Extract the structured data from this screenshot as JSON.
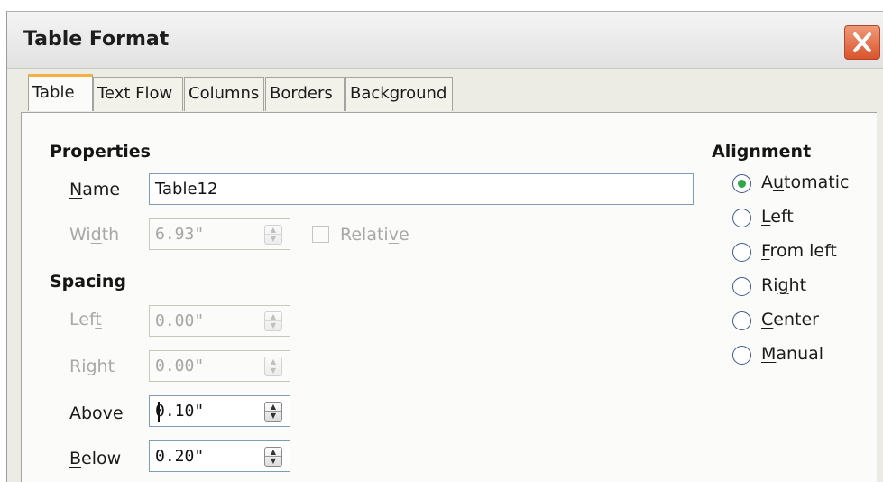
{
  "window": {
    "title": "Table Format"
  },
  "tabs": [
    {
      "label": "Table",
      "active": true
    },
    {
      "label": "Text Flow",
      "active": false
    },
    {
      "label": "Columns",
      "active": false
    },
    {
      "label": "Borders",
      "active": false
    },
    {
      "label": "Background",
      "active": false
    }
  ],
  "properties": {
    "heading": "Properties",
    "name": {
      "label_pre": "",
      "label_u": "N",
      "label_post": "ame",
      "value": "Table12"
    },
    "width": {
      "label_pre": "Wi",
      "label_u": "d",
      "label_post": "th",
      "value": "6.93\""
    },
    "relative": {
      "label_pre": "Relati",
      "label_u": "v",
      "label_post": "e",
      "checked": false
    }
  },
  "spacing": {
    "heading": "Spacing",
    "left": {
      "label_pre": "Lef",
      "label_u": "t",
      "label_post": "",
      "value": "0.00\""
    },
    "right": {
      "label_pre": "Ri",
      "label_u": "g",
      "label_post": "ht",
      "value": "0.00\""
    },
    "above": {
      "label_pre": "",
      "label_u": "A",
      "label_post": "bove",
      "value": "0.10\""
    },
    "below": {
      "label_pre": "",
      "label_u": "B",
      "label_post": "elow",
      "value": "0.20\""
    }
  },
  "alignment": {
    "heading": "Alignment",
    "options": [
      {
        "label_pre": "A",
        "label_u": "u",
        "label_post": "tomatic",
        "checked": true
      },
      {
        "label_pre": "",
        "label_u": "L",
        "label_post": "eft",
        "checked": false
      },
      {
        "label_pre": "",
        "label_u": "F",
        "label_post": "rom left",
        "checked": false
      },
      {
        "label_pre": "Ri",
        "label_u": "g",
        "label_post": "ht",
        "checked": false
      },
      {
        "label_pre": "",
        "label_u": "C",
        "label_post": "enter",
        "checked": false
      },
      {
        "label_pre": "",
        "label_u": "M",
        "label_post": "anual",
        "checked": false
      }
    ]
  },
  "icons": {
    "close": "close-icon",
    "spin_up": "spin-up-arrow",
    "spin_down": "spin-down-arrow"
  },
  "colors": {
    "active_tab_accent": "#f3b243",
    "close_button": "#d9542d",
    "radio_selected": "#2fa84a"
  }
}
